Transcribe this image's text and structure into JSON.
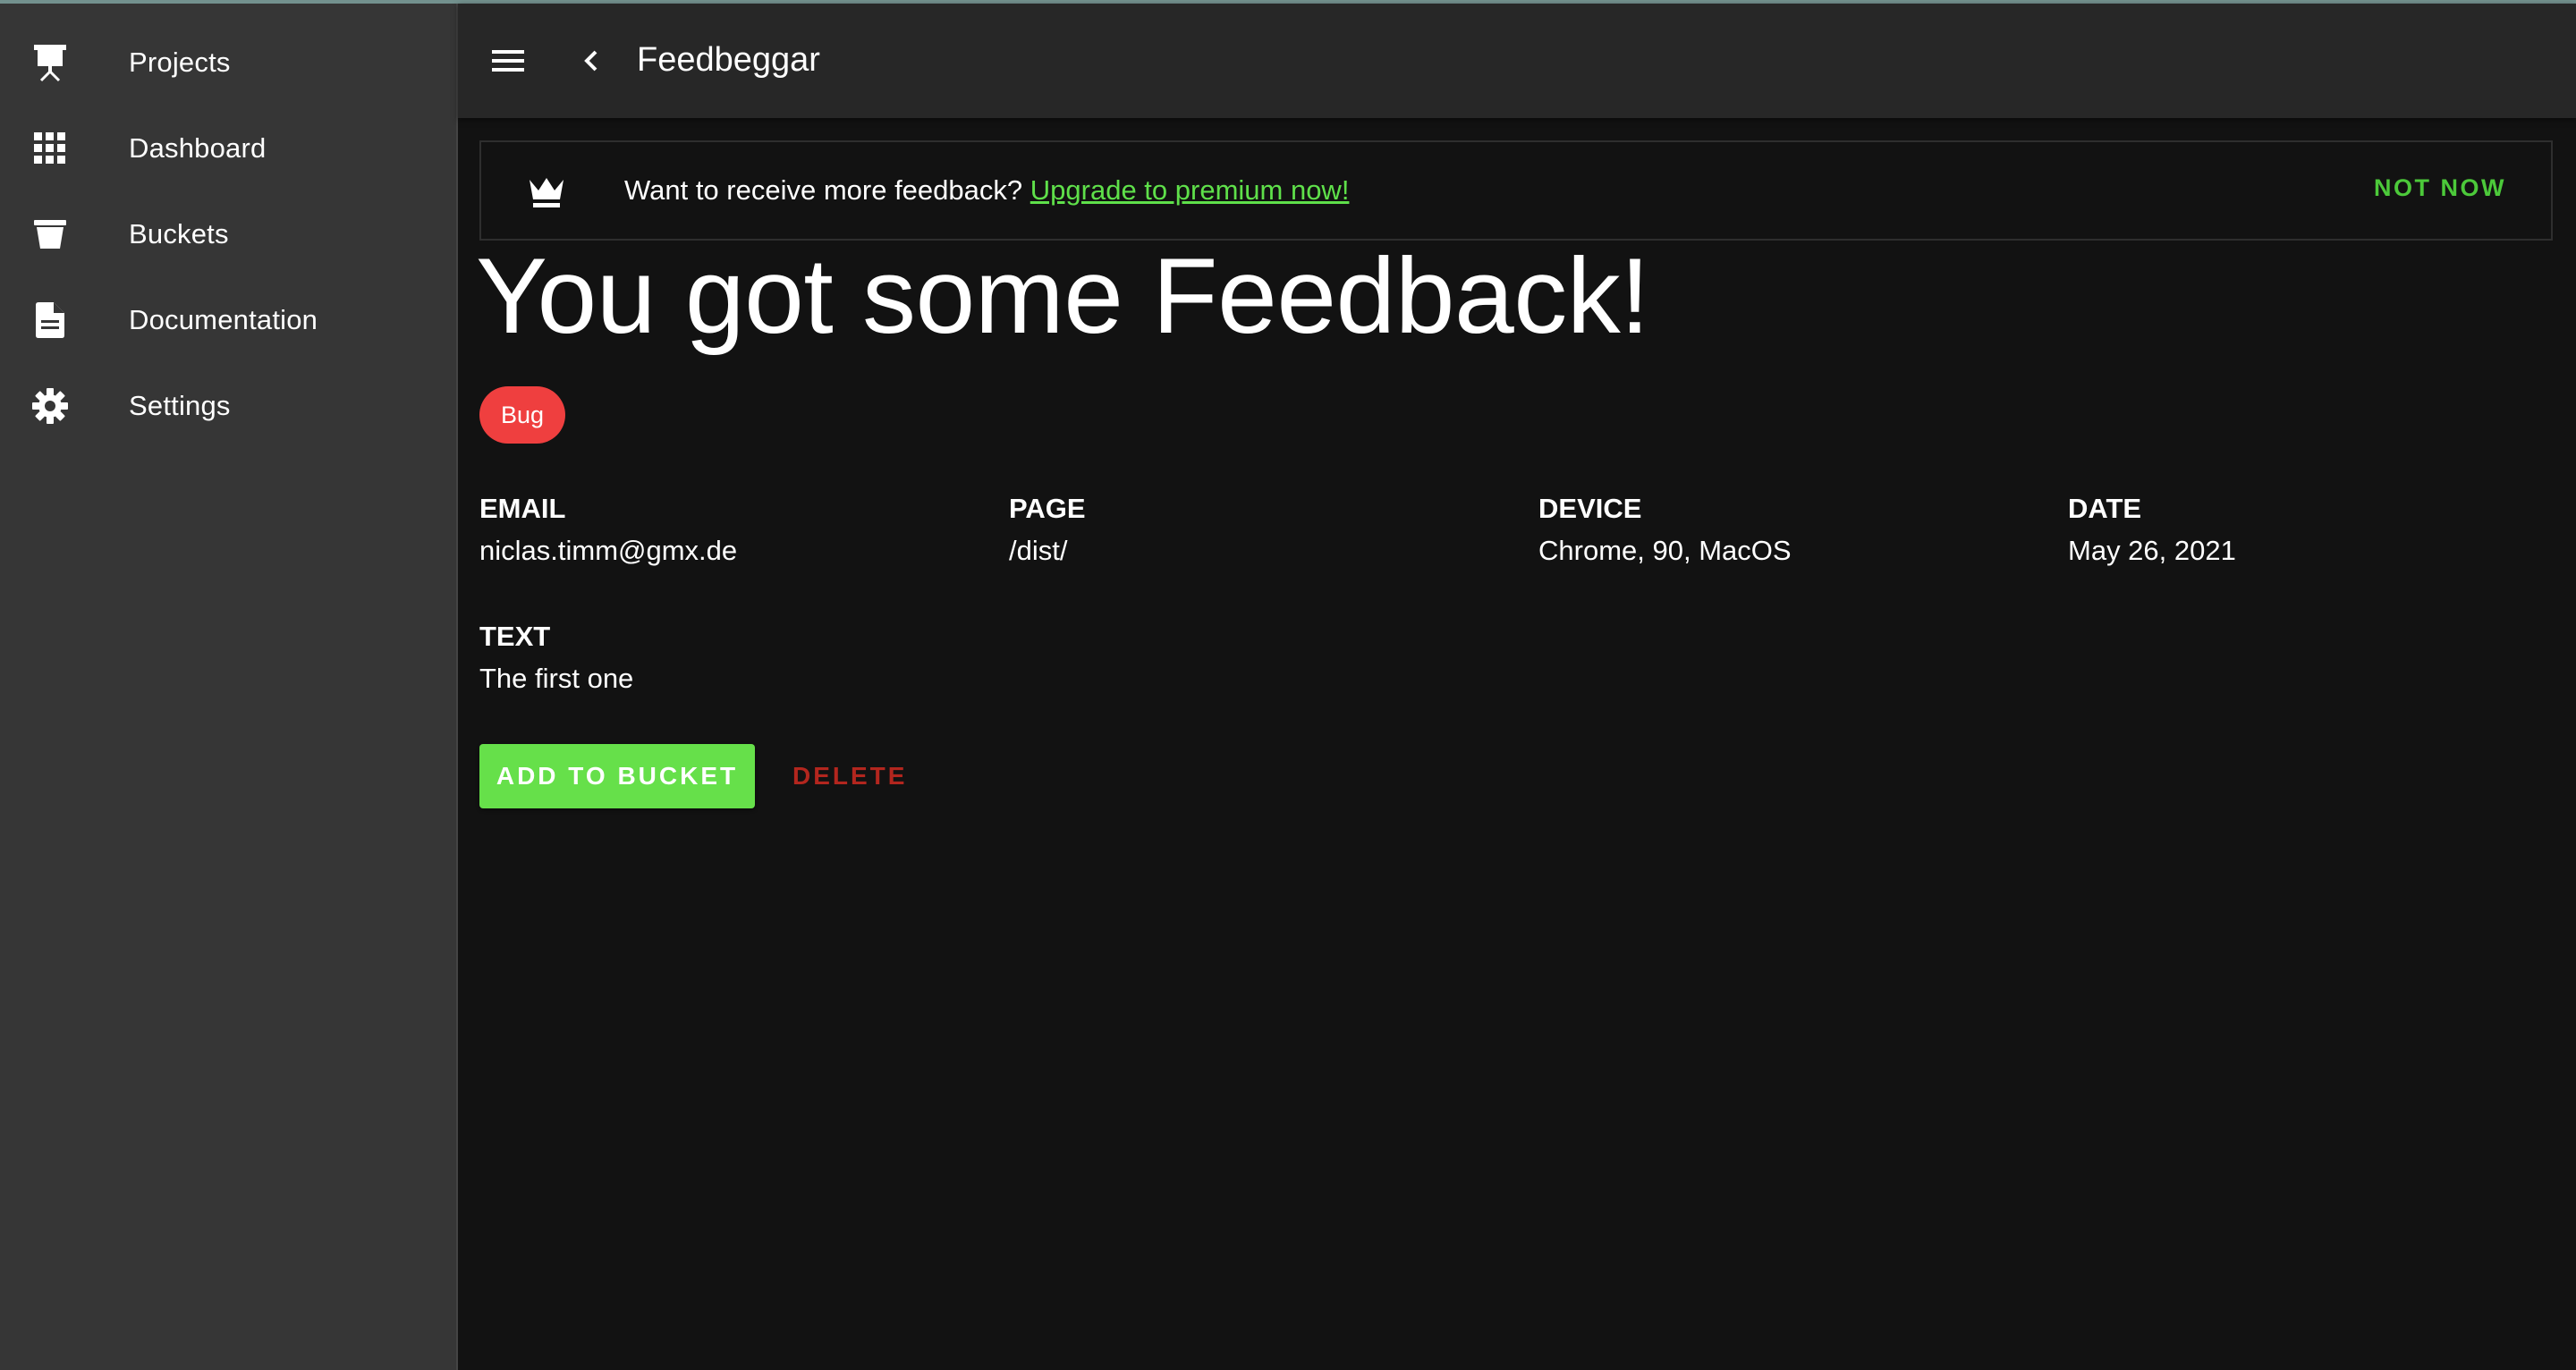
{
  "sidebar": {
    "items": [
      {
        "label": "Projects",
        "icon": "presentation-icon"
      },
      {
        "label": "Dashboard",
        "icon": "grid-icon"
      },
      {
        "label": "Buckets",
        "icon": "bucket-icon"
      },
      {
        "label": "Documentation",
        "icon": "document-icon"
      },
      {
        "label": "Settings",
        "icon": "gear-icon"
      }
    ]
  },
  "header": {
    "title": "Feedbeggar",
    "menu_icon": "hamburger-icon",
    "back_icon": "chevron-left-icon"
  },
  "banner": {
    "icon": "crown-icon",
    "text": "Want to receive more feedback?",
    "link": "Upgrade to premium now!",
    "dismiss": "NOT NOW"
  },
  "feedback": {
    "title": "You got some Feedback!",
    "tag": "Bug",
    "fields": {
      "email": {
        "label": "EMAIL",
        "value": "niclas.timm@gmx.de"
      },
      "page": {
        "label": "PAGE",
        "value": "/dist/"
      },
      "device": {
        "label": "DEVICE",
        "value": "Chrome, 90, MacOS"
      },
      "date": {
        "label": "DATE",
        "value": "May 26, 2021"
      },
      "text": {
        "label": "TEXT",
        "value": "The first one"
      }
    },
    "actions": {
      "add": "ADD TO BUCKET",
      "delete": "DELETE"
    }
  },
  "colors": {
    "accent": "#66e04a",
    "link": "#5fe04a",
    "danger": "#b3261e",
    "tag": "#ef3f3f",
    "sidebar": "#363636",
    "header": "#272727",
    "background": "#121212"
  }
}
